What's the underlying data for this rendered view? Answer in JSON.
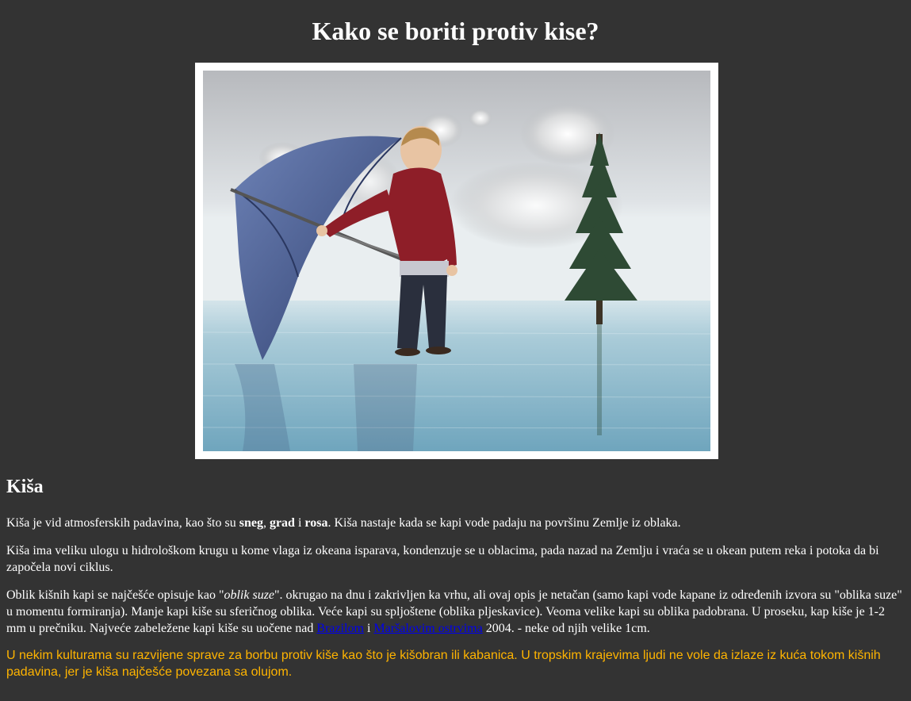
{
  "page": {
    "title": "Kako se boriti protiv kise?"
  },
  "photo": {
    "alt": "Dečak sa kišobranom stoji na vodi pored jelke"
  },
  "section": {
    "heading": "Kiša",
    "p1": {
      "t1": "Kiša je vid atmosferskih padavina, kao što su ",
      "b1": "sneg",
      "t2": ", ",
      "b2": "grad",
      "t3": " i ",
      "b3": "rosa",
      "t4": ". Kiša nastaje kada se kapi vode padaju na površinu Zemlje iz oblaka."
    },
    "p2": "Kiša ima veliku ulogu u hidrološkom krugu u kome vlaga iz okeana isparava, kondenzuje se u oblacima, pada nazad na Zemlju i vraća se u okean putem reka i potoka da bi započela novi ciklus.",
    "p3": {
      "t1": "Oblik kišnih kapi se najčešće opisuje kao \"",
      "em": "oblik suze",
      "t2": "\". okrugao na dnu i zakrivljen ka vrhu, ali ovaj opis je netačan (samo kapi vode kapane iz određenih izvora su \"oblika suze\" u momentu formiranja). Manje kapi kiše su sferičnog oblika. Veće kapi su spljoštene (oblika pljeskavice). Veoma velike kapi su oblika padobrana. U proseku, kap kiše je 1-2 mm u prečniku. Najveće zabeležene kapi kiše su uočene nad ",
      "link1": "Brazilom",
      "t3": " i ",
      "link2": "Maršalovim ostrvima",
      "t4": " 2004. - neke od njih velike 1cm."
    },
    "p4": "U nekim kulturama su razvijene sprave za borbu protiv kiše kao što je kišobran ili kabanica. U tropskim krajevima ljudi ne vole da izlaze iz kuća tokom kišnih padavina, jer je kiša najčešće povezana sa olujom."
  },
  "colors": {
    "background": "#333333",
    "text": "#ffffff",
    "highlight_text": "#ffb400",
    "link": "#0000ee"
  }
}
